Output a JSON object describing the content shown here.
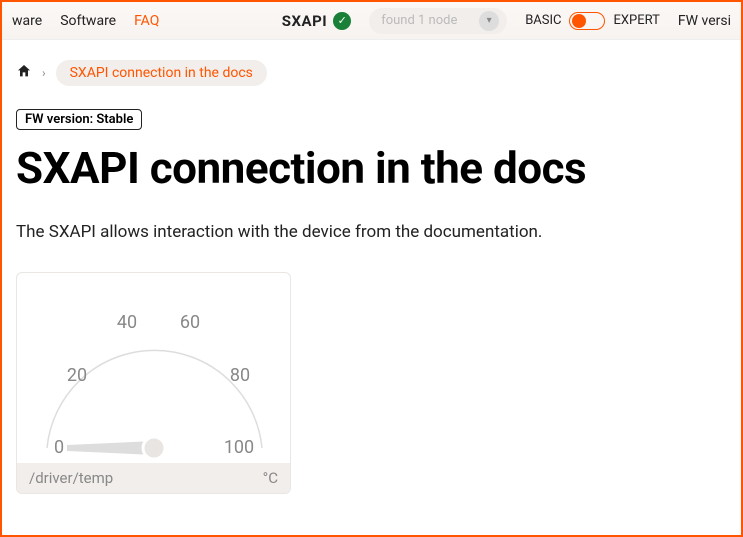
{
  "nav": {
    "items": [
      "ware",
      "Software",
      "FAQ"
    ],
    "activeIndex": 2
  },
  "brand": "SXAPI",
  "search": {
    "placeholder": "found 1 node"
  },
  "mode": {
    "left": "BASIC",
    "right": "EXPERT"
  },
  "tailLink": "FW versi",
  "breadcrumb": {
    "current": "SXAPI connection in the docs"
  },
  "fwBadge": "FW version: Stable",
  "title": "SXAPI connection in the docs",
  "description": "The SXAPI allows interaction with the device from the documentation.",
  "gauge": {
    "ticks": [
      "0",
      "20",
      "40",
      "60",
      "80",
      "100"
    ],
    "path": "/driver/temp",
    "unit": "°C"
  }
}
